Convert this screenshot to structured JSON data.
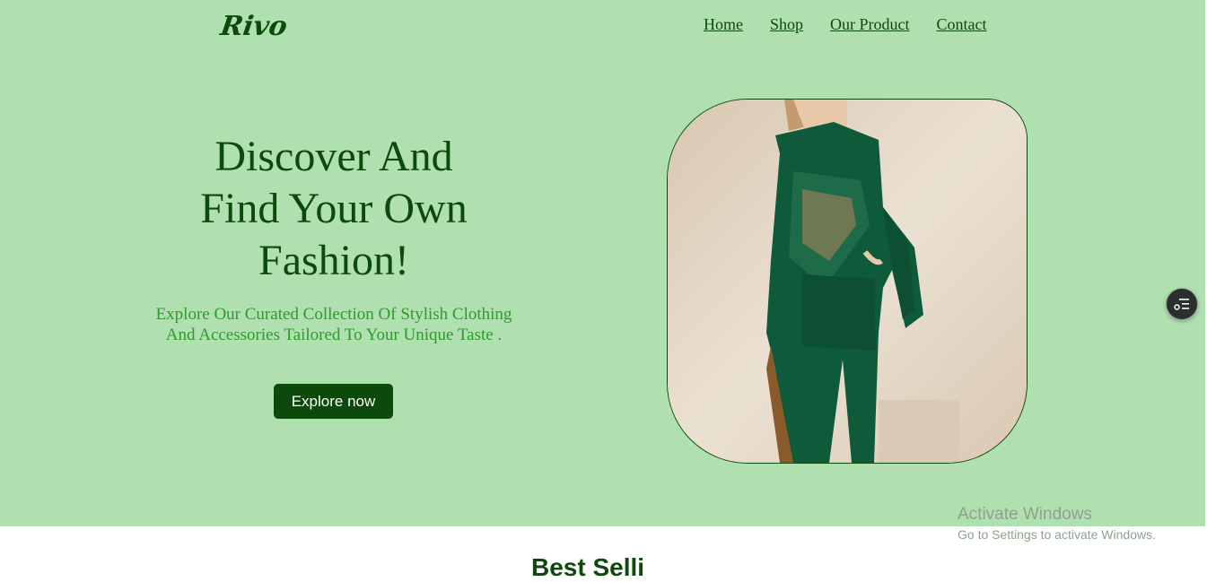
{
  "brand": {
    "logo_text": "Rivo"
  },
  "nav": {
    "items": [
      {
        "label": "Home"
      },
      {
        "label": "Shop"
      },
      {
        "label": "Our Product"
      },
      {
        "label": "Contact"
      }
    ]
  },
  "hero": {
    "headline_line1": "Discover And",
    "headline_line2": "Find Your Own",
    "headline_line3": "Fashion!",
    "subtext": "Explore Our Curated Collection Of Stylish Clothing And Accessories Tailored To Your Unique Taste .",
    "cta_label": "Explore now",
    "image_icon": "fashion-model-image"
  },
  "floating_button": {
    "icon": "menu-list-icon"
  },
  "next_section": {
    "title": "Best Selli"
  },
  "os_watermark": {
    "title": "Activate Windows",
    "subtitle": "Go to Settings to activate Windows."
  },
  "colors": {
    "hero_background": "#b1e0b0",
    "primary_green": "#0b4a0b",
    "accent_green": "#2e9a2e"
  }
}
